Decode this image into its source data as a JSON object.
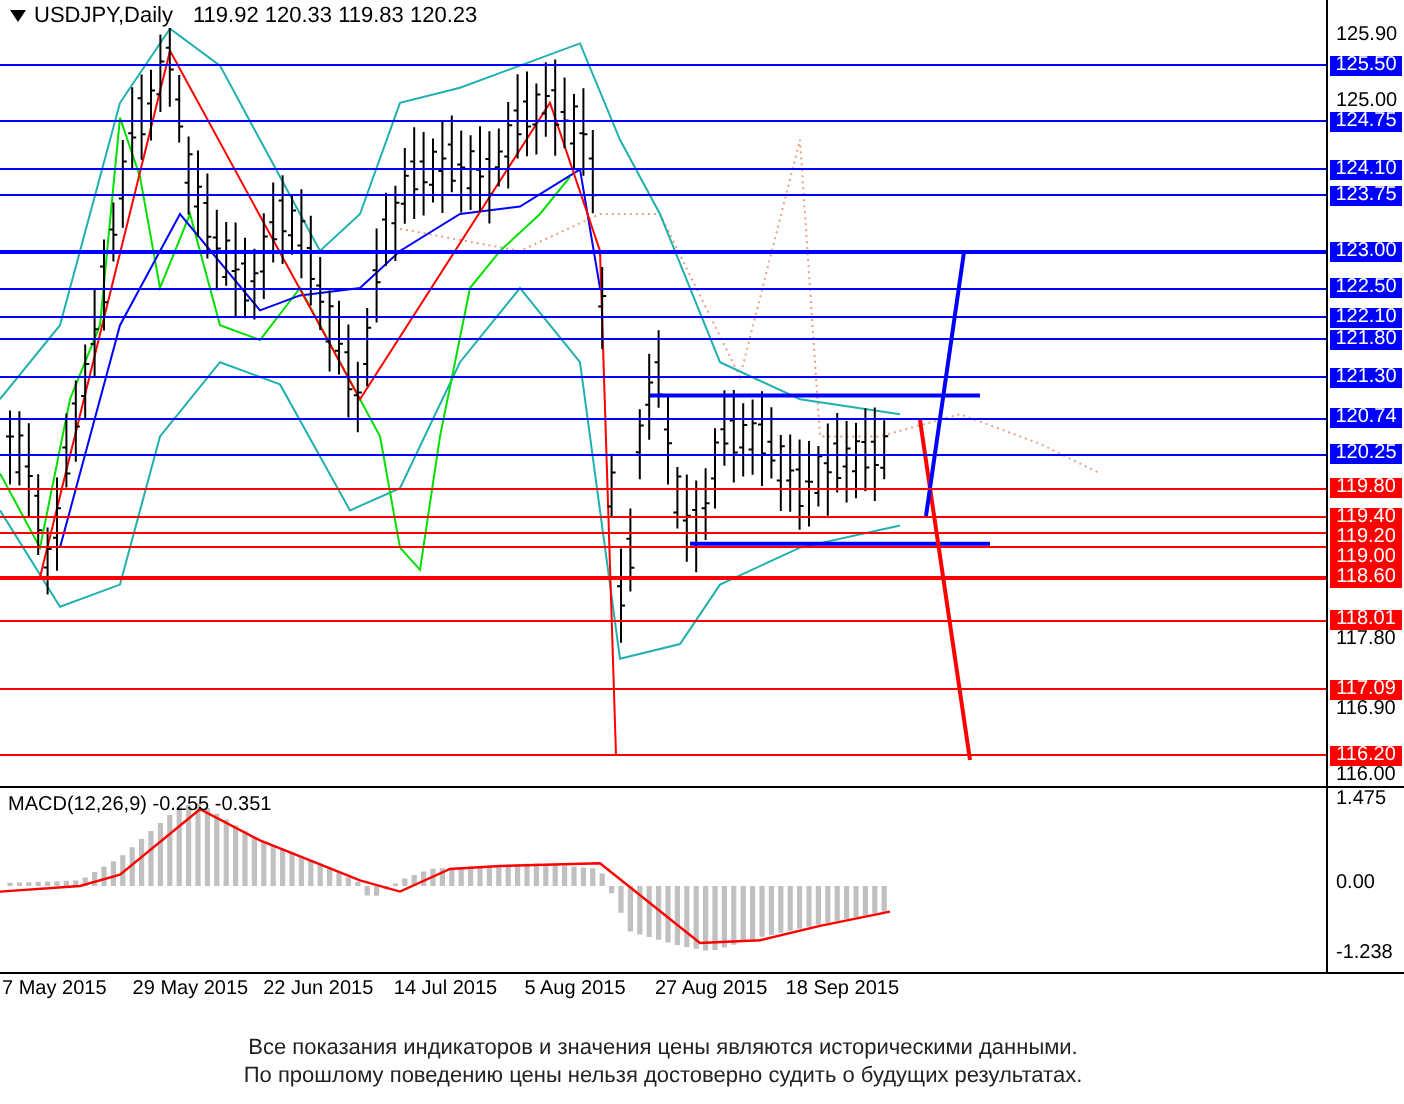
{
  "header": {
    "symbol": "USDJPY,Daily",
    "ohlc": "119.92 120.33 119.83 120.23"
  },
  "price_axis": {
    "ticks": [
      "125.90",
      "125.00",
      "117.80",
      "116.90",
      "116.00"
    ]
  },
  "levels": [
    {
      "price": "125.50",
      "color": "#0000ff",
      "thick": false
    },
    {
      "price": "124.75",
      "color": "#0000ff",
      "thick": false
    },
    {
      "price": "124.10",
      "color": "#0000ff",
      "thick": false
    },
    {
      "price": "123.75",
      "color": "#0000ff",
      "thick": false
    },
    {
      "price": "123.00",
      "color": "#0000ff",
      "thick": true
    },
    {
      "price": "122.50",
      "color": "#0000ff",
      "thick": false
    },
    {
      "price": "122.10",
      "color": "#0000ff",
      "thick": false
    },
    {
      "price": "121.80",
      "color": "#0000ff",
      "thick": false
    },
    {
      "price": "121.30",
      "color": "#0000ff",
      "thick": false
    },
    {
      "price": "120.74",
      "color": "#0000ff",
      "thick": false
    },
    {
      "price": "120.25",
      "color": "#0000ff",
      "thick": false
    },
    {
      "price": "119.80",
      "color": "#ff0000",
      "thick": false
    },
    {
      "price": "119.40",
      "color": "#ff0000",
      "thick": false
    },
    {
      "price": "119.20",
      "color": "#ff0000",
      "thick": false
    },
    {
      "price": "119.00",
      "color": "#ff0000",
      "thick": false
    },
    {
      "price": "118.60",
      "color": "#ff0000",
      "thick": true
    },
    {
      "price": "118.01",
      "color": "#ff0000",
      "thick": false
    },
    {
      "price": "117.09",
      "color": "#ff0000",
      "thick": false
    },
    {
      "price": "116.20",
      "color": "#ff0000",
      "thick": false
    }
  ],
  "macd": {
    "title": "MACD(12,26,9) -0.255 -0.351",
    "ticks": [
      "1.475",
      "0.00",
      "-1.238"
    ]
  },
  "dates": [
    "7 May 2015",
    "29 May 2015",
    "22 Jun 2015",
    "14 Jul 2015",
    "5 Aug 2015",
    "27 Aug 2015",
    "18 Sep 2015"
  ],
  "disclaimer": [
    "Все показания индикаторов и значения цены являются историческими данными.",
    "По прошлому поведению цены нельзя достоверно судить о будущих результатах."
  ]
}
